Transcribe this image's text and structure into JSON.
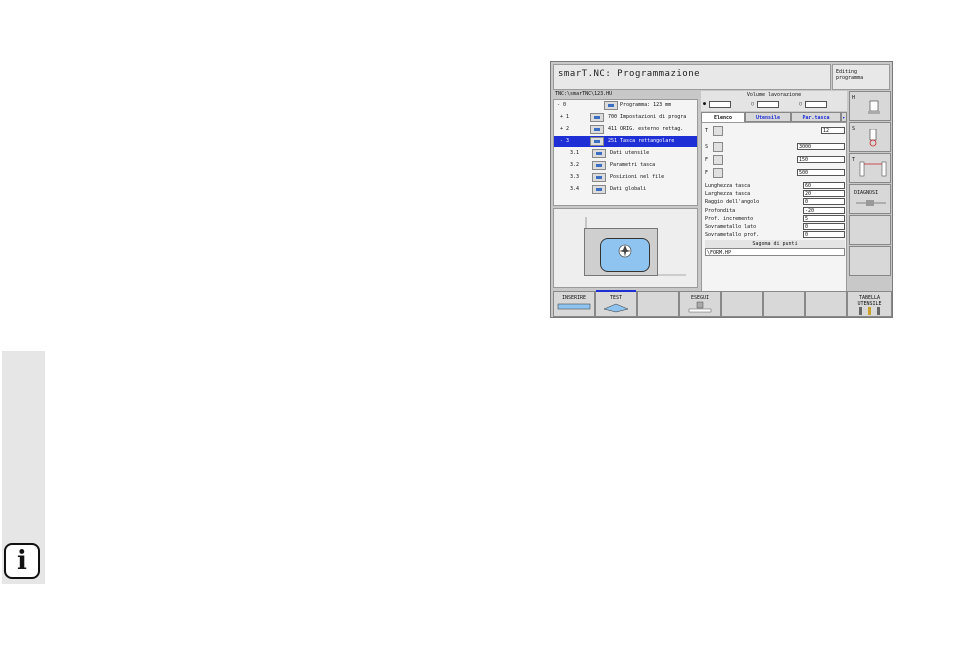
{
  "info_icon": "i",
  "screen": {
    "title": "smarT.NC: Programmazione",
    "mode": [
      "Editing",
      "programma"
    ],
    "path": "TNC:\\smarTNC\\123.HU",
    "tree": [
      {
        "num": "- 0",
        "label": "Programma: 123 mm",
        "selected": false
      },
      {
        "num": "+ 1",
        "label": "700 Impostazioni di progra",
        "selected": false
      },
      {
        "num": "+ 2",
        "label": "411 ORIG. esterno rettag.",
        "selected": false
      },
      {
        "num": "- 3",
        "label": "251 Tasca rettangolare",
        "selected": true
      },
      {
        "num": "3.1",
        "label": "Dati utensile",
        "selected": false
      },
      {
        "num": "3.2",
        "label": "Parametri tasca",
        "selected": false
      },
      {
        "num": "3.3",
        "label": "Posizioni nel file",
        "selected": false
      },
      {
        "num": "3.4",
        "label": "Dati globali",
        "selected": false
      }
    ],
    "volume_header": "Volume lavorazione",
    "tabs": [
      "Elenco",
      "Utensile",
      "Par.tasca"
    ],
    "tool_fields": [
      {
        "label": "T",
        "value": "12"
      },
      {
        "label": "S",
        "value": "3000"
      },
      {
        "label": "F",
        "value": "150"
      },
      {
        "label": "F",
        "value": "500"
      }
    ],
    "params": [
      {
        "label": "Lunghezza tasca",
        "value": "60"
      },
      {
        "label": "Larghezza tasca",
        "value": "20"
      },
      {
        "label": "Raggio dell'angolo",
        "value": "0"
      },
      {
        "label": "Profondita",
        "value": "-20"
      },
      {
        "label": "Prof. incremento",
        "value": "5"
      },
      {
        "label": "Sovrametallo lato",
        "value": "0"
      },
      {
        "label": "Sovrametallo prof.",
        "value": "0"
      }
    ],
    "pattern_header": "Sagoma di punti",
    "pattern_file": "\\FORM.HP",
    "right_keys": [
      "H",
      "S",
      "T",
      "DIAGNOSI",
      "",
      ""
    ],
    "bottom_keys": [
      "INSERIRE",
      "TEST",
      "",
      "ESEGUI",
      "",
      "",
      "",
      "TABELLA UTENSILE"
    ]
  }
}
